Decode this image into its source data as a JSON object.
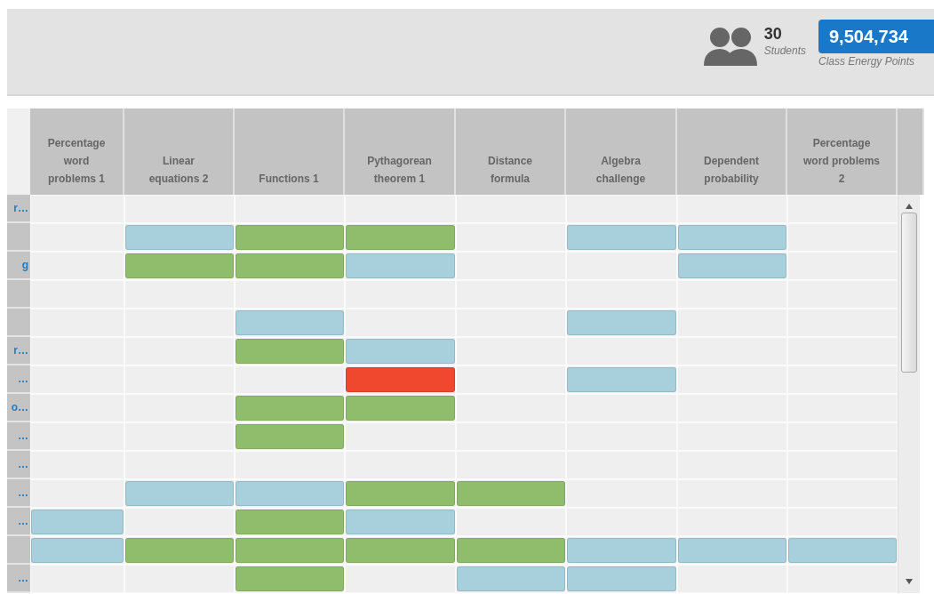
{
  "summary": {
    "students_count": "30",
    "students_label": "Students",
    "points": "9,504,734",
    "points_label": "Class Energy Points"
  },
  "columns": [
    "Percentage word problems 1",
    "Linear equations 2",
    "Functions 1",
    "Pythagorean theorem 1",
    "Distance formula",
    "Algebra challenge",
    "Dependent probability",
    "Percentage word problems 2"
  ],
  "rows": [
    {
      "name": "r…",
      "cells": [
        {
          "kind": "empty"
        },
        {
          "kind": "empty"
        },
        {
          "kind": "empty"
        },
        {
          "kind": "empty"
        },
        {
          "kind": "empty"
        },
        {
          "kind": "empty"
        },
        {
          "kind": "empty"
        },
        {
          "kind": "empty"
        }
      ]
    },
    {
      "cells": [
        {
          "kind": "empty"
        },
        {
          "kind": "bar",
          "color": "#a8cfdc"
        },
        {
          "kind": "bar",
          "color": "#8fbd6c"
        },
        {
          "kind": "bar",
          "color": "#8fbd6c"
        },
        {
          "kind": "empty"
        },
        {
          "kind": "bar",
          "color": "#a8cfdc"
        },
        {
          "kind": "bar",
          "color": "#a8cfdc"
        },
        {
          "kind": "empty"
        }
      ]
    },
    {
      "name": "g",
      "cells": [
        {
          "kind": "empty"
        },
        {
          "kind": "bar",
          "color": "#8fbd6c"
        },
        {
          "kind": "bar",
          "color": "#8fbd6c"
        },
        {
          "kind": "bar",
          "color": "#a8cfdc"
        },
        {
          "kind": "empty"
        },
        {
          "kind": "empty"
        },
        {
          "kind": "bar",
          "color": "#a8cfdc"
        },
        {
          "kind": "empty"
        }
      ]
    },
    {
      "cells": [
        {
          "kind": "empty"
        },
        {
          "kind": "empty"
        },
        {
          "kind": "empty"
        },
        {
          "kind": "empty"
        },
        {
          "kind": "empty"
        },
        {
          "kind": "empty"
        },
        {
          "kind": "empty"
        },
        {
          "kind": "empty"
        }
      ]
    },
    {
      "cells": [
        {
          "kind": "empty"
        },
        {
          "kind": "empty"
        },
        {
          "kind": "bar",
          "color": "#a8cfdc"
        },
        {
          "kind": "empty"
        },
        {
          "kind": "empty"
        },
        {
          "kind": "bar",
          "color": "#a8cfdc"
        },
        {
          "kind": "empty"
        },
        {
          "kind": "empty"
        }
      ]
    },
    {
      "name": "r…",
      "cells": [
        {
          "kind": "empty"
        },
        {
          "kind": "empty"
        },
        {
          "kind": "bar",
          "color": "#8fbd6c"
        },
        {
          "kind": "bar",
          "color": "#a8cfdc"
        },
        {
          "kind": "empty"
        },
        {
          "kind": "empty"
        },
        {
          "kind": "empty"
        },
        {
          "kind": "empty"
        }
      ]
    },
    {
      "name": "…",
      "cells": [
        {
          "kind": "empty"
        },
        {
          "kind": "empty"
        },
        {
          "kind": "empty"
        },
        {
          "kind": "bar",
          "color": "#f0472f"
        },
        {
          "kind": "empty"
        },
        {
          "kind": "bar",
          "color": "#a8cfdc"
        },
        {
          "kind": "empty"
        },
        {
          "kind": "empty"
        }
      ]
    },
    {
      "name": "o…",
      "cells": [
        {
          "kind": "empty"
        },
        {
          "kind": "empty"
        },
        {
          "kind": "bar",
          "color": "#8fbd6c"
        },
        {
          "kind": "bar",
          "color": "#8fbd6c"
        },
        {
          "kind": "empty"
        },
        {
          "kind": "empty"
        },
        {
          "kind": "empty"
        },
        {
          "kind": "empty"
        }
      ]
    },
    {
      "name": "…",
      "cells": [
        {
          "kind": "empty"
        },
        {
          "kind": "empty"
        },
        {
          "kind": "bar",
          "color": "#8fbd6c"
        },
        {
          "kind": "empty"
        },
        {
          "kind": "empty"
        },
        {
          "kind": "empty"
        },
        {
          "kind": "empty"
        },
        {
          "kind": "empty"
        }
      ]
    },
    {
      "name": "…",
      "cells": [
        {
          "kind": "empty"
        },
        {
          "kind": "empty"
        },
        {
          "kind": "empty"
        },
        {
          "kind": "empty"
        },
        {
          "kind": "empty"
        },
        {
          "kind": "empty"
        },
        {
          "kind": "empty"
        },
        {
          "kind": "empty"
        }
      ]
    },
    {
      "name": "…",
      "cells": [
        {
          "kind": "empty"
        },
        {
          "kind": "bar",
          "color": "#a8cfdc"
        },
        {
          "kind": "bar",
          "color": "#a8cfdc"
        },
        {
          "kind": "bar",
          "color": "#8fbd6c"
        },
        {
          "kind": "bar",
          "color": "#8fbd6c"
        },
        {
          "kind": "empty"
        },
        {
          "kind": "empty"
        },
        {
          "kind": "empty"
        }
      ]
    },
    {
      "name": "…",
      "cells": [
        {
          "kind": "bar",
          "color": "#a8cfdc"
        },
        {
          "kind": "empty"
        },
        {
          "kind": "bar",
          "color": "#8fbd6c"
        },
        {
          "kind": "bar",
          "color": "#a8cfdc"
        },
        {
          "kind": "empty"
        },
        {
          "kind": "empty"
        },
        {
          "kind": "empty"
        },
        {
          "kind": "empty"
        }
      ]
    },
    {
      "cells": [
        {
          "kind": "bar",
          "color": "#a8cfdc"
        },
        {
          "kind": "bar",
          "color": "#8fbd6c"
        },
        {
          "kind": "bar",
          "color": "#8fbd6c"
        },
        {
          "kind": "bar",
          "color": "#8fbd6c"
        },
        {
          "kind": "bar",
          "color": "#8fbd6c"
        },
        {
          "kind": "bar",
          "color": "#a8cfdc"
        },
        {
          "kind": "bar",
          "color": "#a8cfdc"
        },
        {
          "kind": "bar",
          "color": "#a8cfdc"
        }
      ]
    },
    {
      "name": "…",
      "cells": [
        {
          "kind": "empty"
        },
        {
          "kind": "empty"
        },
        {
          "kind": "bar",
          "color": "#8fbd6c"
        },
        {
          "kind": "empty"
        },
        {
          "kind": "bar",
          "color": "#a8cfdc"
        },
        {
          "kind": "bar",
          "color": "#a8cfdc"
        },
        {
          "kind": "empty"
        },
        {
          "kind": "empty"
        }
      ]
    }
  ]
}
